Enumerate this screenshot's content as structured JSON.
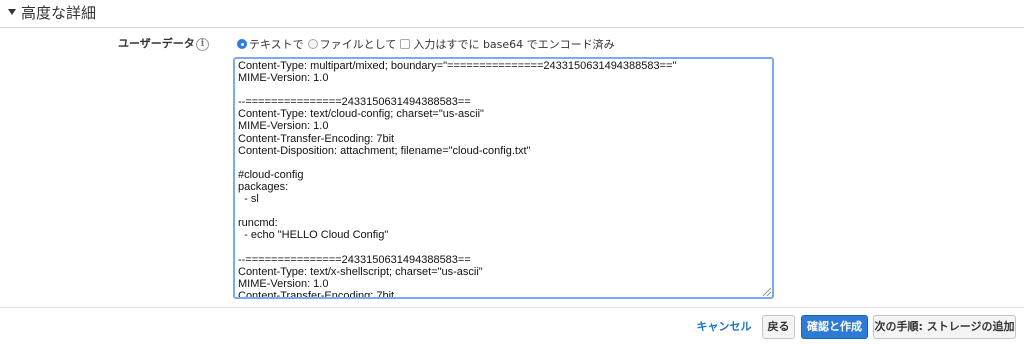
{
  "section": {
    "title": "高度な詳細"
  },
  "user_data": {
    "label": "ユーザーデータ",
    "info_glyph": "i",
    "options": {
      "as_text": "テキストで",
      "as_file": "ファイルとして",
      "base64_checkbox": "入力はすでに base64 でエンコード済み"
    },
    "selected_option": "as_text",
    "content": "Content-Type: multipart/mixed; boundary=\"===============2433150631494388583==\"\nMIME-Version: 1.0\n\n--===============2433150631494388583==\nContent-Type: text/cloud-config; charset=\"us-ascii\"\nMIME-Version: 1.0\nContent-Transfer-Encoding: 7bit\nContent-Disposition: attachment; filename=\"cloud-config.txt\"\n\n#cloud-config\npackages:\n  - sl\n\nruncmd:\n  - echo \"HELLO Cloud Config\"\n\n--===============2433150631494388583==\nContent-Type: text/x-shellscript; charset=\"us-ascii\"\nMIME-Version: 1.0\nContent-Transfer-Encoding: 7bit\nContent-Disposition: attachment; filename=\"shell.txt\""
  },
  "footer": {
    "cancel": "キャンセル",
    "back": "戻る",
    "review_launch": "確認と作成",
    "next": "次の手順: ストレージの追加"
  },
  "colors": {
    "primary": "#2e7bd6",
    "link": "#1a73c9",
    "focus_border": "#7baaf0"
  }
}
